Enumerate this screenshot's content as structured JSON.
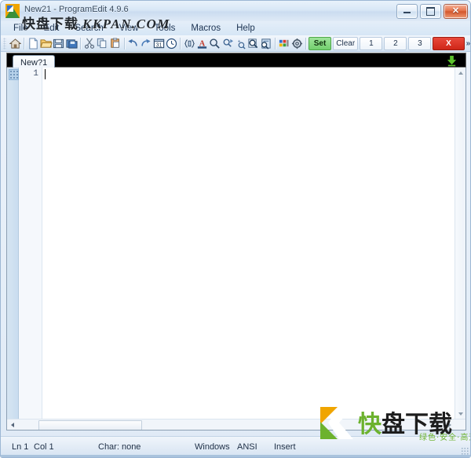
{
  "window": {
    "title": "New21 - ProgramEdit 4.9.6",
    "app_icon": "programedit-icon",
    "controls": {
      "minimize": "minimize-button",
      "maximize": "maximize-button",
      "close_glyph": "✕"
    }
  },
  "watermark": {
    "top_cn": "快盘下载",
    "top_latin": "KKPAN.COM",
    "logo_cn_1": "快",
    "logo_cn_2": "盘下载",
    "logo_sub": "绿色·安全·高速",
    "logo_mark": "K",
    "green": "#6cb22e",
    "orange": "#f0a500"
  },
  "menubar": {
    "items": [
      {
        "label": "File"
      },
      {
        "label": "Edit"
      },
      {
        "label": "Search"
      },
      {
        "label": "View"
      },
      {
        "label": "Tools"
      },
      {
        "label": "Macros"
      },
      {
        "label": "Help"
      }
    ]
  },
  "toolbar": {
    "icons": [
      {
        "name": "home-icon"
      },
      {
        "name": "new-file-icon"
      },
      {
        "name": "open-folder-icon"
      },
      {
        "name": "save-icon"
      },
      {
        "name": "save-all-icon"
      },
      {
        "name": "cut-icon"
      },
      {
        "name": "copy-icon"
      },
      {
        "name": "paste-icon"
      },
      {
        "name": "undo-icon"
      },
      {
        "name": "redo-icon"
      },
      {
        "name": "calendar-icon"
      },
      {
        "name": "clock-icon"
      },
      {
        "name": "brackets-icon"
      },
      {
        "name": "font-color-icon"
      },
      {
        "name": "find-icon"
      },
      {
        "name": "find-next-icon"
      },
      {
        "name": "goto-line-icon"
      },
      {
        "name": "find-in-files-icon"
      },
      {
        "name": "replace-in-files-icon"
      },
      {
        "name": "color-palette-icon"
      },
      {
        "name": "settings-gear-icon"
      }
    ],
    "calendar_day": "31",
    "font_letter": "A",
    "buttons": [
      {
        "name": "set-button",
        "label": "Set",
        "style": "set"
      },
      {
        "name": "clear-button",
        "label": "Clear",
        "style": "plain"
      },
      {
        "name": "bookmark-1-button",
        "label": "1",
        "style": "plain"
      },
      {
        "name": "bookmark-2-button",
        "label": "2",
        "style": "plain"
      },
      {
        "name": "bookmark-3-button",
        "label": "3",
        "style": "plain"
      },
      {
        "name": "close-all-button",
        "label": "X",
        "style": "x"
      }
    ],
    "overflow_chevron": "»"
  },
  "tabs": {
    "items": [
      {
        "label": "New?1",
        "active": true
      }
    ],
    "download_icon": "download-arrow-icon"
  },
  "editor": {
    "line_numbers": [
      "1"
    ],
    "content": "",
    "caret_line": 1,
    "caret_col": 1
  },
  "statusbar": {
    "line": "Ln 1",
    "column": "Col 1",
    "character": "Char: none",
    "line_ending": "Windows",
    "encoding": "ANSI",
    "insert_mode": "Insert"
  }
}
